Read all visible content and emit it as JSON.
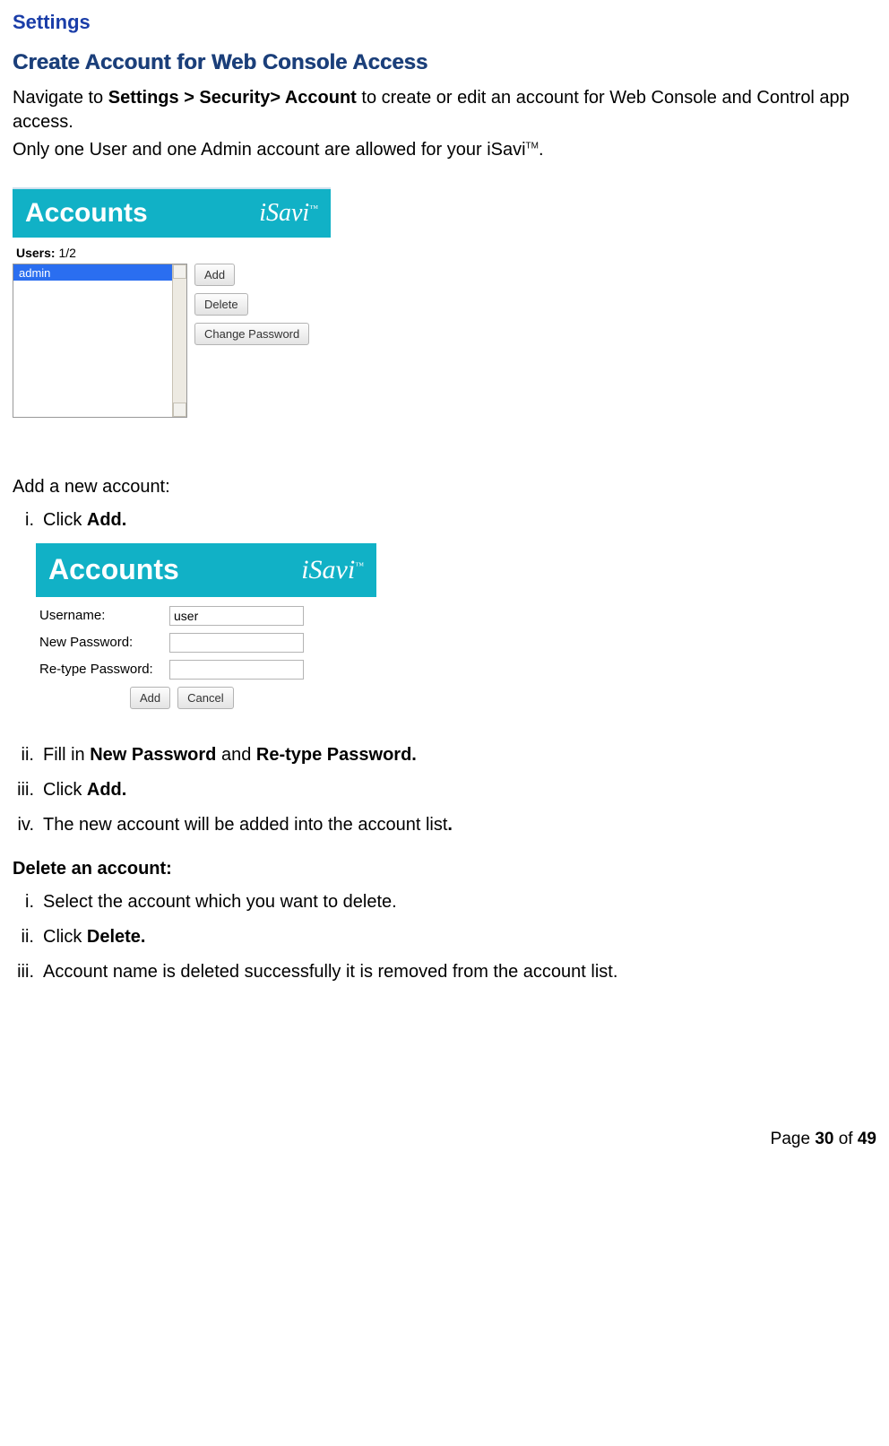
{
  "h_settings": "Settings",
  "h_create": "Create Account for Web Console Access",
  "para1a": "Navigate to ",
  "para1b": "Settings > Security> Account",
  "para1c": " to create or edit an account for Web Console and Control app access.",
  "para2a": "Only one User and one Admin account are allowed for your iSavi",
  "tm": "TM",
  "para2b": ".",
  "panel_title": "Accounts",
  "brand": "iSavi",
  "brand_tm": "™",
  "users_lbl": "Users:",
  "users_val": " 1/2",
  "list_item": "admin",
  "btn_add": "Add",
  "btn_delete": "Delete",
  "btn_change": "Change Password",
  "add_new_hdr": "Add a new account:",
  "step_i": "i.",
  "step_ii": "ii.",
  "step_iii": "iii.",
  "step_iv": "iv.",
  "s1a": "Click ",
  "s1b": "Add.",
  "form": {
    "username_lbl": "Username:",
    "username_val": "user",
    "newpass_lbl": "New Password:",
    "retype_lbl": "Re-type Password:",
    "add": "Add",
    "cancel": "Cancel"
  },
  "s2a": "Fill in ",
  "s2b": "New Password",
  "s2c": " and ",
  "s2d": "Re-type Password.",
  "s3a": "Click ",
  "s3b": "Add.",
  "s4a": "The new account will be added into the account list",
  "s4b": ".",
  "delete_hdr": "Delete an account:",
  "d1": "Select the account which you want to delete.",
  "d2a": "Click ",
  "d2b": "Delete.",
  "d3": "Account name is deleted successfully it is removed from the account list.",
  "footer_a": "Page ",
  "footer_b": "30",
  "footer_c": " of ",
  "footer_d": "49"
}
